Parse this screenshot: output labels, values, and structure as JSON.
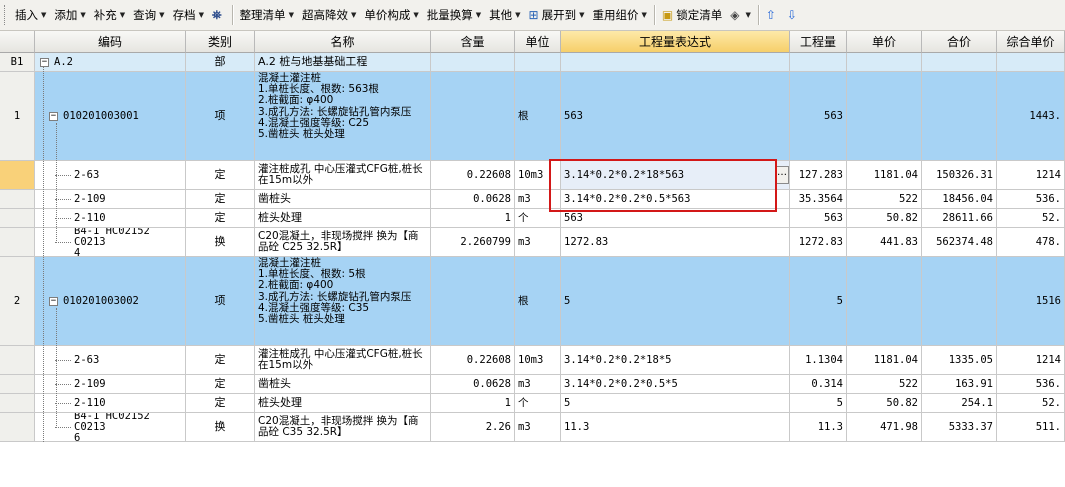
{
  "toolbar": {
    "items": [
      {
        "label": "插入",
        "dropdown": true
      },
      {
        "label": "添加",
        "dropdown": true
      },
      {
        "label": "补充",
        "dropdown": true
      },
      {
        "label": "查询",
        "dropdown": true
      },
      {
        "label": "存档",
        "dropdown": true
      },
      {
        "label": "整理清单",
        "dropdown": true
      },
      {
        "label": "超高降效",
        "dropdown": true
      },
      {
        "label": "单价构成",
        "dropdown": true
      },
      {
        "label": "批量换算",
        "dropdown": true
      },
      {
        "label": "其他",
        "dropdown": true
      },
      {
        "label": "展开到",
        "dropdown": true
      },
      {
        "label": "重用组价",
        "dropdown": true
      },
      {
        "label": "锁定清单",
        "dropdown": false
      }
    ],
    "icons": [
      "binoculars-icon",
      "expand-tree-icon",
      "lock-icon",
      "paint-bucket-icon",
      "move-up-icon",
      "move-down-icon"
    ]
  },
  "columns": [
    "编码",
    "类别",
    "名称",
    "含量",
    "单位",
    "工程量表达式",
    "工程量",
    "单价",
    "合价",
    "综合单价"
  ],
  "rows": [
    {
      "idx": "B1",
      "code": "A.2",
      "type": "部",
      "name": "A.2  桩与地基基础工程",
      "qty_ratio": "",
      "unit": "",
      "expr": "",
      "qty": "",
      "price": "",
      "total": "",
      "unit_price": ""
    },
    {
      "idx": "1",
      "code": "010201003001",
      "type": "项",
      "name": "混凝土灌注桩\n1.单桩长度、根数: 563根\n2.桩截面: φ400\n3.成孔方法: 长螺旋钻孔管内泵压\n4.混凝土强度等级: C25\n5.凿桩头 桩头处理",
      "qty_ratio": "",
      "unit": "根",
      "expr": "563",
      "qty": "563",
      "price": "",
      "total": "",
      "unit_price": "1443."
    },
    {
      "idx": "",
      "code": "2-63",
      "type": "定",
      "name": "灌注桩成孔 中心压灌式CFG桩,桩长在15m以外",
      "qty_ratio": "0.22608",
      "unit": "10m3",
      "expr": "3.14*0.2*0.2*18*563",
      "qty": "127.283",
      "price": "1181.04",
      "total": "150326.31",
      "unit_price": "1214"
    },
    {
      "idx": "",
      "code": "2-109",
      "type": "定",
      "name": "凿桩头",
      "qty_ratio": "0.0628",
      "unit": "m3",
      "expr": "3.14*0.2*0.2*0.5*563",
      "qty": "35.3564",
      "price": "522",
      "total": "18456.04",
      "unit_price": "536."
    },
    {
      "idx": "",
      "code": "2-110",
      "type": "定",
      "name": "桩头处理",
      "qty_ratio": "1",
      "unit": "个",
      "expr": "563",
      "qty": "563",
      "price": "50.82",
      "total": "28611.66",
      "unit_price": "52."
    },
    {
      "idx": "",
      "code": "B4-1 HC02152 C0213\n4",
      "type": "换",
      "name": "C20混凝土，非现场搅拌 换为【商品砼 C25 32.5R】",
      "qty_ratio": "2.260799",
      "unit": "m3",
      "expr": "1272.83",
      "qty": "1272.83",
      "price": "441.83",
      "total": "562374.48",
      "unit_price": "478."
    },
    {
      "idx": "2",
      "code": "010201003002",
      "type": "项",
      "name": "混凝土灌注桩\n1.单桩长度、根数: 5根\n2.桩截面: φ400\n3.成孔方法: 长螺旋钻孔管内泵压\n4.混凝土强度等级: C35\n5.凿桩头 桩头处理",
      "qty_ratio": "",
      "unit": "根",
      "expr": "5",
      "qty": "5",
      "price": "",
      "total": "",
      "unit_price": "1516"
    },
    {
      "idx": "",
      "code": "2-63",
      "type": "定",
      "name": "灌注桩成孔 中心压灌式CFG桩,桩长在15m以外",
      "qty_ratio": "0.22608",
      "unit": "10m3",
      "expr": "3.14*0.2*0.2*18*5",
      "qty": "1.1304",
      "price": "1181.04",
      "total": "1335.05",
      "unit_price": "1214"
    },
    {
      "idx": "",
      "code": "2-109",
      "type": "定",
      "name": "凿桩头",
      "qty_ratio": "0.0628",
      "unit": "m3",
      "expr": "3.14*0.2*0.2*0.5*5",
      "qty": "0.314",
      "price": "522",
      "total": "163.91",
      "unit_price": "536."
    },
    {
      "idx": "",
      "code": "2-110",
      "type": "定",
      "name": "桩头处理",
      "qty_ratio": "1",
      "unit": "个",
      "expr": "5",
      "qty": "5",
      "price": "50.82",
      "total": "254.1",
      "unit_price": "52."
    },
    {
      "idx": "",
      "code": "B4-1 HC02152 C0213\n6",
      "type": "换",
      "name": "C20混凝土，非现场搅拌  换为【商品砼 C35 32.5R】",
      "qty_ratio": "2.26",
      "unit": "m3",
      "expr": "11.3",
      "qty": "11.3",
      "price": "471.98",
      "total": "5333.37",
      "unit_price": "511."
    }
  ],
  "colors": {
    "accent_band": "#a6d3f4",
    "header_row": "#d7ebf8",
    "highlight": "#d31818",
    "selected_header": "#f6cf6a"
  },
  "selected_row": 2,
  "selected_column": "工程量表达式"
}
